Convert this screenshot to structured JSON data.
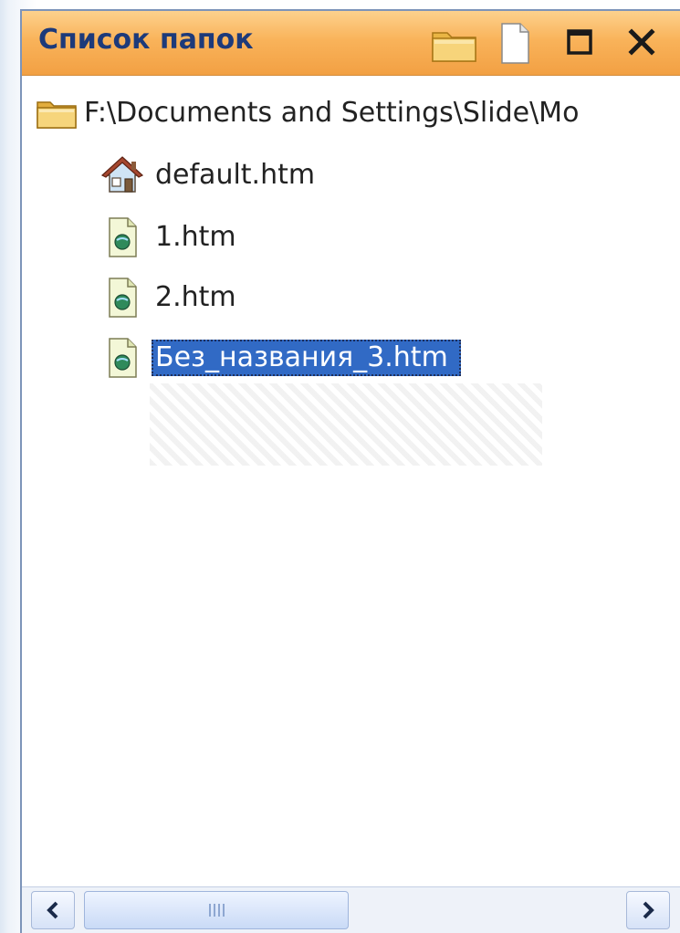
{
  "panel": {
    "title": "Список папок"
  },
  "tree": {
    "root": {
      "label": "F:\\Documents and Settings\\Slide\\Mo",
      "icon": "folder-icon"
    },
    "items": [
      {
        "label": "default.htm",
        "icon": "home-page-icon",
        "selected": false
      },
      {
        "label": "1.htm",
        "icon": "html-file-icon",
        "selected": false
      },
      {
        "label": "2.htm",
        "icon": "html-file-icon",
        "selected": false
      },
      {
        "label": "Без_названия_3.htm",
        "icon": "html-file-icon",
        "selected": true
      }
    ]
  },
  "scrollbar": {
    "left_arrow": "<",
    "right_arrow": ">",
    "grip": "|||"
  },
  "colors": {
    "titlebar": "#f9b35a",
    "title_text": "#1d3a7a",
    "selection": "#316ac5",
    "border": "#7d94b9"
  }
}
